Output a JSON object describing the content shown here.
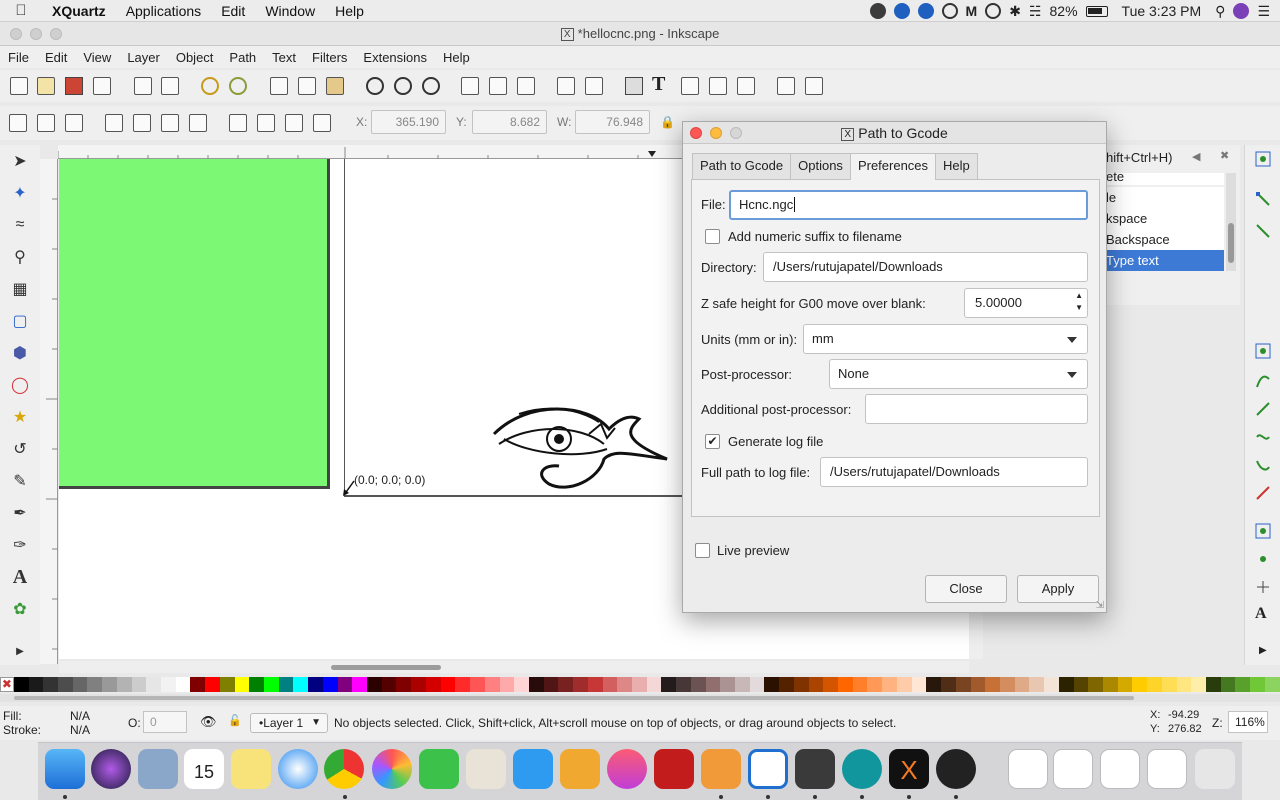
{
  "menubar": {
    "apple": "",
    "items": [
      "XQuartz",
      "Applications",
      "Edit",
      "Window",
      "Help"
    ],
    "battery": "82%",
    "clock": "Tue 3:23 PM"
  },
  "window": {
    "title": "*hellocnc.png - Inkscape"
  },
  "appmenu": [
    "File",
    "Edit",
    "View",
    "Layer",
    "Object",
    "Path",
    "Text",
    "Filters",
    "Extensions",
    "Help"
  ],
  "toolctrl": {
    "x_label": "X:",
    "x_value": "365.190",
    "y_label": "Y:",
    "y_value": "8.682",
    "w_label": "W:",
    "w_value": "76.948"
  },
  "canvas": {
    "coord_label": "(0.0; 0.0; 0.0)"
  },
  "dock_panel": {
    "shortcut_hint": "hift+Ctrl+H)",
    "rows": [
      "ete",
      "le",
      "kspace",
      "Backspace",
      "Type text"
    ],
    "selected": "Type text"
  },
  "dialog": {
    "title": "Path to Gcode",
    "tabs": [
      "Path to Gcode",
      "Options",
      "Preferences",
      "Help"
    ],
    "active_tab": "Preferences",
    "file_label": "File:",
    "file_value": "Hcnc.ngc",
    "suffix_label": "Add numeric suffix to filename",
    "suffix_checked": false,
    "directory_label": "Directory:",
    "directory_value": "/Users/rutujapatel/Downloads",
    "zsafe_label": "Z safe height for G00 move over blank:",
    "zsafe_value": "5.00000",
    "units_label": "Units (mm or in):",
    "units_value": "mm",
    "post_label": "Post-processor:",
    "post_value": "None",
    "addpost_label": "Additional post-processor:",
    "addpost_value": "",
    "log_label": "Generate log file",
    "log_checked": true,
    "logpath_label": "Full path to log file:",
    "logpath_value": "/Users/rutujapatel/Downloads",
    "live_label": "Live preview",
    "live_checked": false,
    "close_label": "Close",
    "apply_label": "Apply"
  },
  "status": {
    "fill_label": "Fill:",
    "fill_value": "N/A",
    "stroke_label": "Stroke:",
    "stroke_value": "N/A",
    "opacity_label": "O:",
    "opacity_value": "0",
    "layer": "•Layer 1",
    "message": "No objects selected. Click, Shift+click, Alt+scroll mouse on top of objects, or drag around objects to select.",
    "x_label": "X:",
    "x_value": "-94.29",
    "y_label": "Y:",
    "y_value": "276.82",
    "zoom_label": "Z:",
    "zoom_value": "116%"
  },
  "colors": {
    "green_fill": "#7cf874",
    "selection": "#3d7ad6",
    "focus_ring": "#6b9bd8"
  }
}
